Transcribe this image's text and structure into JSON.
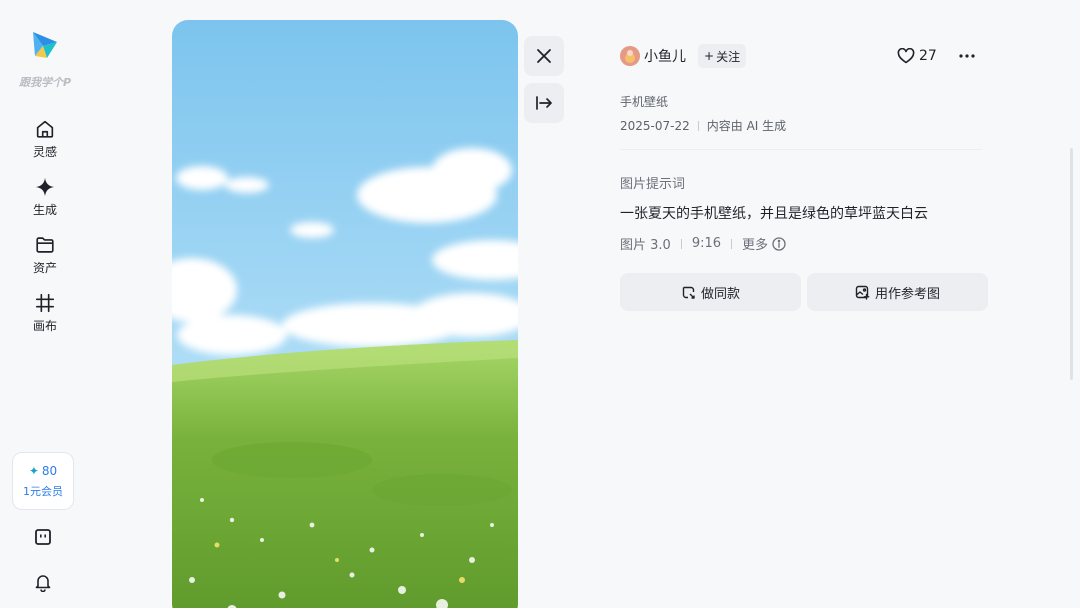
{
  "sidebar": {
    "brand": "跟我学个P",
    "items": [
      {
        "label": "灵感",
        "icon": "home-icon"
      },
      {
        "label": "生成",
        "icon": "sparkle-icon"
      },
      {
        "label": "资产",
        "icon": "folder-icon"
      },
      {
        "label": "画布",
        "icon": "canvas-icon"
      }
    ],
    "credits": {
      "count": "80",
      "member": "1元会员"
    },
    "bottom_icons": [
      "robot-icon",
      "bell-icon"
    ]
  },
  "post": {
    "author": "小鱼儿",
    "follow_label": "关注",
    "likes": "27",
    "category": "手机壁纸",
    "date": "2025-07-22",
    "ai_note": "内容由 AI 生成",
    "prompt_label": "图片提示词",
    "prompt": "一张夏天的手机壁纸，并且是绿色的草坪蓝天白云",
    "model": "图片 3.0",
    "ratio": "9:16",
    "more": "更多",
    "actions": {
      "same": "做同款",
      "reference": "用作参考图"
    }
  },
  "colors": {
    "accent": "#2d7ee8",
    "button_bg": "#eceef1",
    "page_bg": "#f7f8fa"
  }
}
